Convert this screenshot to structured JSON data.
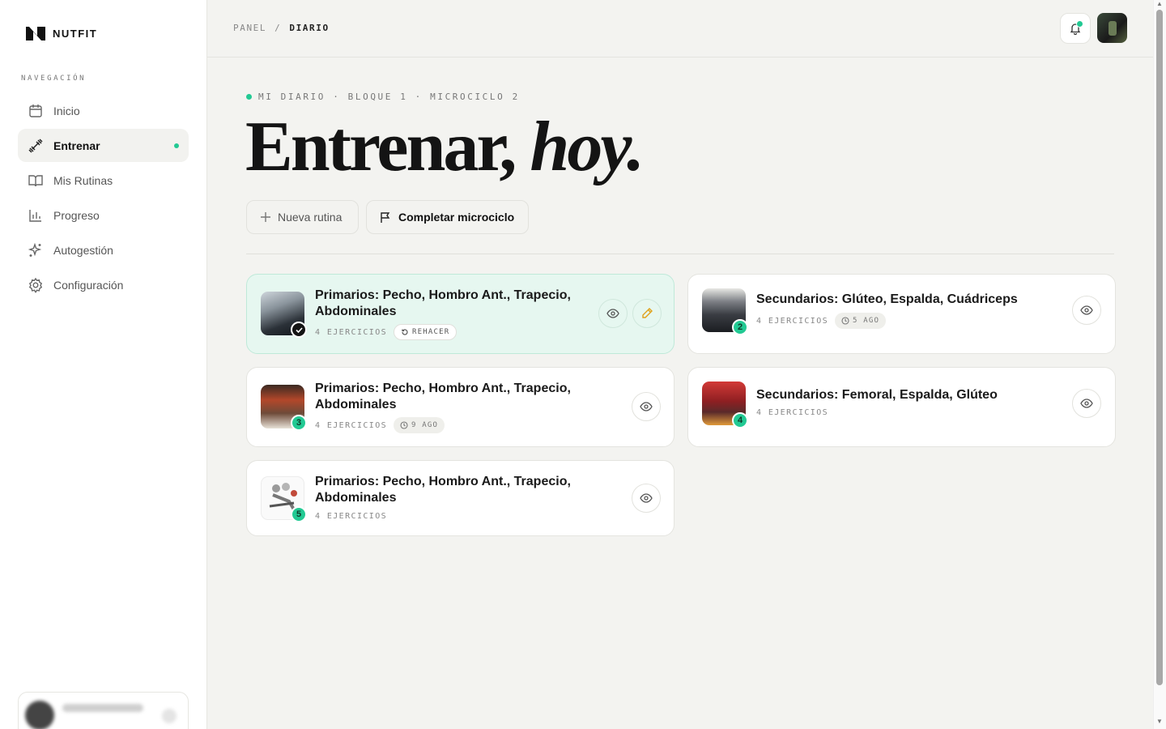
{
  "brand": {
    "name": "NUTFIT"
  },
  "sidebar": {
    "section_label": "NAVEGACIÓN",
    "items": [
      {
        "label": "Inicio",
        "icon": "calendar-icon",
        "active": false
      },
      {
        "label": "Entrenar",
        "icon": "dumbbell-icon",
        "active": true
      },
      {
        "label": "Mis Rutinas",
        "icon": "book-icon",
        "active": false
      },
      {
        "label": "Progreso",
        "icon": "bar-chart-icon",
        "active": false
      },
      {
        "label": "Autogestión",
        "icon": "sparkles-icon",
        "active": false
      },
      {
        "label": "Configuración",
        "icon": "gear-icon",
        "active": false
      }
    ]
  },
  "header": {
    "breadcrumb": [
      "PANEL",
      "DIARIO"
    ],
    "separator": "/"
  },
  "hero": {
    "eyebrow": "MI DIARIO · BLOQUE 1 · MICROCICLO 2",
    "title_main": "Entrenar,",
    "title_italic": "hoy."
  },
  "actions": {
    "new_routine": "Nueva rutina",
    "complete_microcycle": "Completar microciclo"
  },
  "routines": [
    {
      "title": "Primarios: Pecho, Hombro Ant., Trapecio, Abdominales",
      "exercises": "4 EJERCICIOS",
      "badge": "",
      "status": "done",
      "chip": "REHACER"
    },
    {
      "title": "Secundarios: Glúteo, Espalda, Cuádriceps",
      "exercises": "4 EJERCICIOS",
      "badge": "2",
      "status": "pending",
      "chip": "5 AGO"
    },
    {
      "title": "Primarios: Pecho, Hombro Ant., Trapecio, Abdominales",
      "exercises": "4 EJERCICIOS",
      "badge": "3",
      "status": "pending",
      "chip": "9 AGO"
    },
    {
      "title": "Secundarios: Femoral, Espalda, Glúteo",
      "exercises": "4 EJERCICIOS",
      "badge": "4",
      "status": "pending",
      "chip": ""
    },
    {
      "title": "Primarios: Pecho, Hombro Ant., Trapecio, Abdominales",
      "exercises": "4 EJERCICIOS",
      "badge": "5",
      "status": "pending",
      "chip": ""
    }
  ],
  "colors": {
    "accent": "#22c993",
    "done_bg": "#e6f7f0",
    "bg": "#f3f3f0"
  }
}
